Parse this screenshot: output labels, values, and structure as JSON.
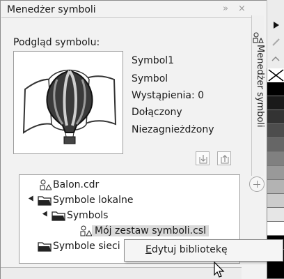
{
  "titlebar": {
    "title": "Menedżer symboli",
    "collapse_glyph": "»",
    "close_glyph": "×"
  },
  "preview": {
    "label": "Podgląd symbolu:",
    "image_icon": "hot-air-balloon-flag-icon"
  },
  "info": {
    "name": "Symbol1",
    "type": "Symbol",
    "instances": "Wystąpienia: 0",
    "link_status": "Dołączony",
    "nesting": "Niezagnieżdżony"
  },
  "buttons": {
    "import_icon": "arrow-down-box-icon",
    "export_icon": "arrow-up-box-icon"
  },
  "tree": {
    "items": [
      {
        "label": "Balon.cdr",
        "icon": "document-symbols-icon"
      },
      {
        "label": "Symbole lokalne",
        "icon": "folder-icon"
      },
      {
        "label": "Symbols",
        "icon": "folder-icon"
      },
      {
        "label": "Mój zestaw symboli.csl",
        "icon": "document-symbols-icon"
      },
      {
        "label": "Symbole sieci",
        "icon": "folder-icon"
      }
    ]
  },
  "context_menu": {
    "items": [
      {
        "label": "Edytuj bibliotekę"
      }
    ]
  },
  "side_tab": {
    "label": "Menedżer symboli",
    "icon": "symbol-manager-icon"
  },
  "palette": {
    "colors": [
      "#ffffff",
      "#000000",
      "#1a1a1a",
      "#333333",
      "#4d4d4d",
      "#666666",
      "#808080",
      "#999999",
      "#b3b3b3",
      "#cccccc",
      "#e6e6e6",
      "#ffffff",
      "#000000",
      "#000000"
    ]
  }
}
